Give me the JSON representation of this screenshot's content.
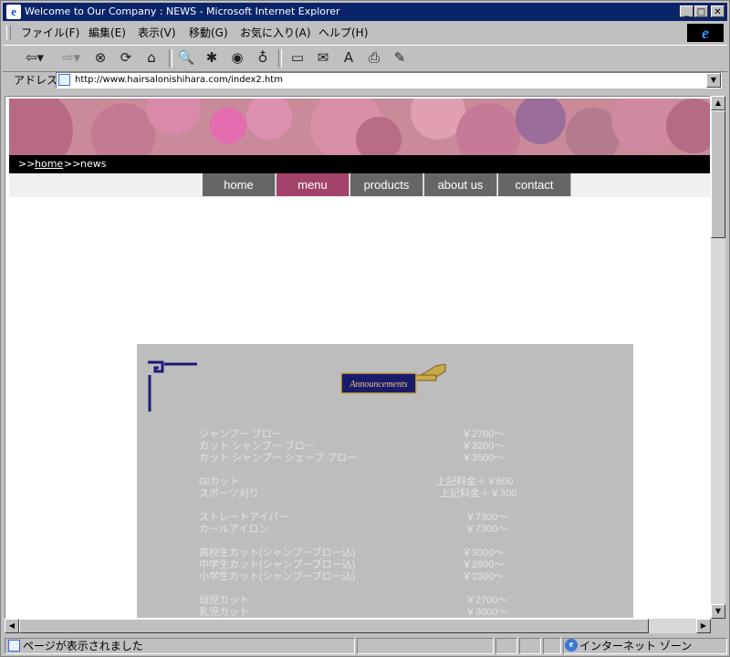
{
  "window": {
    "title": "Welcome to Our Company : NEWS - Microsoft Internet Explorer"
  },
  "menubar": {
    "items": [
      "ファイル(F)",
      "編集(E)",
      "表示(V)",
      "移動(G)",
      "お気に入り(A)",
      "ヘルプ(H)"
    ]
  },
  "addressbar": {
    "label": "アドレス",
    "url": "http://www.hairsalonishihara.com/index2.htm"
  },
  "page": {
    "breadcrumb": {
      "prefix": ">>",
      "home": "home",
      "sep": ">>",
      "current": "news"
    },
    "nav": [
      "home",
      "menu",
      "products",
      "about us",
      "contact"
    ],
    "nav_active": "menu",
    "announcement_badge": "Announcements",
    "price_groups": [
      [
        {
          "item": "シャンプー ブロー",
          "price": "￥2700～"
        },
        {
          "item": "カット シャンプー ブロー",
          "price": "￥3200～"
        },
        {
          "item": "カット シャンプー シェーブ ブロー",
          "price": "￥3500～"
        }
      ],
      [
        {
          "item": "GIカット",
          "price": "上記料金＋￥600"
        },
        {
          "item": "スポーツ刈り",
          "price": "上記料金＋￥300"
        }
      ],
      [
        {
          "item": "ストレートアイパー",
          "price": "￥7300～"
        },
        {
          "item": "カールアイロン",
          "price": "￥7300～"
        }
      ],
      [
        {
          "item": "高校生カット(シャンプーブロー込)",
          "price": "￥3000～"
        },
        {
          "item": "中学生カット(シャンプーブロー込)",
          "price": "￥2800～"
        },
        {
          "item": "小学生カット(シャンプーブロー込)",
          "price": "￥2300～"
        }
      ],
      [
        {
          "item": "幼児カット",
          "price": "￥2700～"
        },
        {
          "item": "乳児カット",
          "price": "￥3000～"
        }
      ]
    ]
  },
  "statusbar": {
    "text": "ページが表示されました",
    "zone": "インターネット ゾーン"
  },
  "colors": {
    "title_bar": "#0a246a",
    "nav_active": "#a3426b",
    "nav_default": "#666666",
    "panel": "#bdbdbd",
    "ornament": "#1a1a7a"
  }
}
